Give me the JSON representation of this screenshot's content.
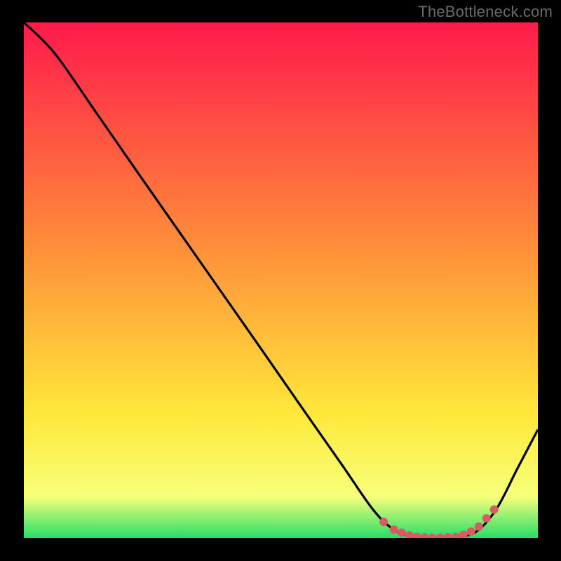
{
  "attribution": "TheBottleneck.com",
  "colors": {
    "page_bg": "#000000",
    "curve": "#000000",
    "marker_fill": "#d85a63",
    "marker_stroke": "#d85a63",
    "gradient_top": "#ff1a4b",
    "gradient_orange": "#ff8a3a",
    "gradient_yellow": "#ffe83a",
    "gradient_green": "#28de68"
  },
  "chart_data": {
    "type": "line",
    "title": "",
    "xlabel": "",
    "ylabel": "",
    "xlim": [
      0,
      100
    ],
    "ylim": [
      0,
      100
    ],
    "series": [
      {
        "name": "bottleneck-curve",
        "x": [
          0,
          6,
          14,
          22,
          30,
          38,
          46,
          54,
          62,
          68,
          72,
          76,
          80,
          84,
          88,
          92,
          96,
          100
        ],
        "y": [
          100,
          94,
          82.6,
          71.1,
          59.7,
          48.3,
          36.9,
          25.4,
          14,
          5.4,
          1.6,
          0.2,
          0,
          0.2,
          1.2,
          5.7,
          13.4,
          21
        ]
      }
    ],
    "markers": {
      "name": "sweet-spot-points",
      "x": [
        70,
        72,
        73.5,
        75,
        76.5,
        78,
        79.5,
        81,
        82.5,
        84,
        85.5,
        87,
        88.5,
        90,
        91.5
      ],
      "y": [
        3.1,
        1.6,
        1.0,
        0.5,
        0.2,
        0.1,
        0,
        0,
        0.1,
        0.2,
        0.6,
        1.2,
        2.2,
        3.8,
        5.5
      ]
    }
  }
}
